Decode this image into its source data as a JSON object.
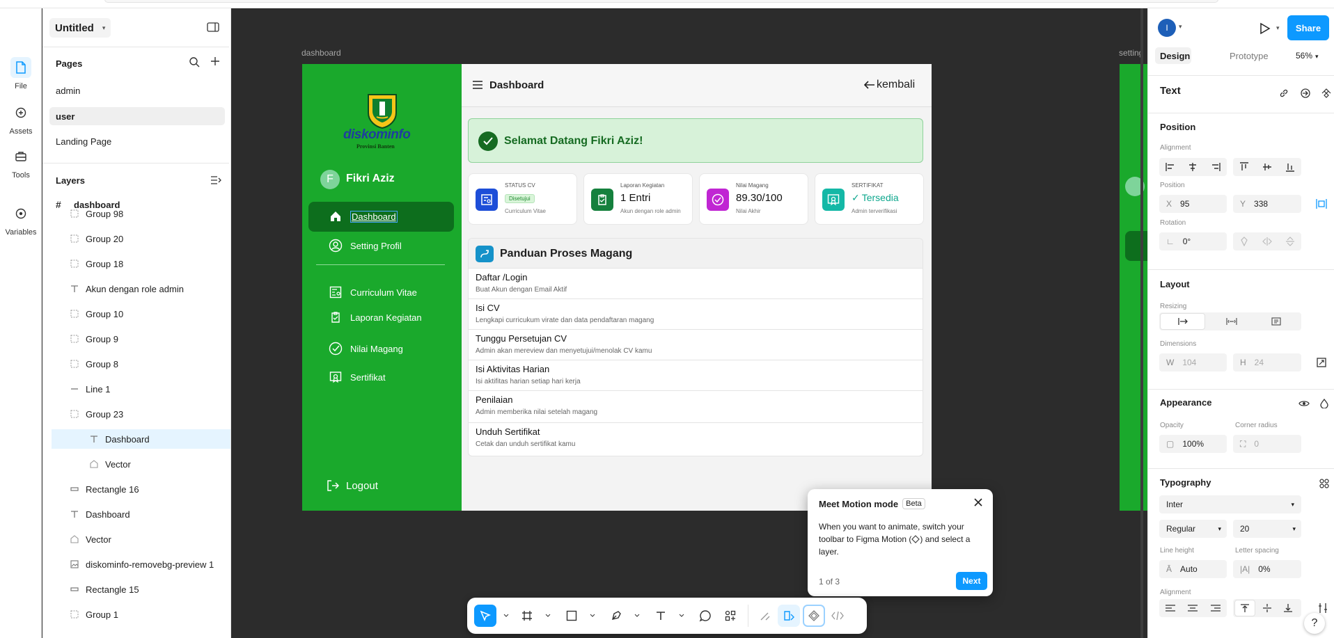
{
  "app": {
    "file_name": "Untitled",
    "accent": "#0d99ff"
  },
  "rail": {
    "file_label": "File",
    "assets_label": "Assets",
    "tools_label": "Tools",
    "variables_label": "Variables"
  },
  "pages": {
    "heading": "Pages",
    "items": [
      "admin",
      "user",
      "Landing Page"
    ],
    "selected": "user"
  },
  "layers": {
    "heading": "Layers",
    "root": "dashboard",
    "items": [
      {
        "label": "Group 98",
        "icon": "group-icon"
      },
      {
        "label": "Group 20",
        "icon": "group-icon"
      },
      {
        "label": "Group 18",
        "icon": "group-icon"
      },
      {
        "label": "Akun dengan role admin",
        "icon": "text-icon"
      },
      {
        "label": "Group 10",
        "icon": "group-icon"
      },
      {
        "label": "Group 9",
        "icon": "group-icon"
      },
      {
        "label": "Group 8",
        "icon": "group-icon"
      },
      {
        "label": "Line 1",
        "icon": "line-icon"
      },
      {
        "label": "Group 23",
        "icon": "group-icon"
      },
      {
        "label": "Dashboard",
        "icon": "text-icon"
      },
      {
        "label": "Vector",
        "icon": "vector-icon"
      },
      {
        "label": "Rectangle 16",
        "icon": "rectangle-icon"
      },
      {
        "label": "Dashboard",
        "icon": "text-icon"
      },
      {
        "label": "Vector",
        "icon": "vector-icon"
      },
      {
        "label": "diskominfo-removebg-preview 1",
        "icon": "image-icon"
      },
      {
        "label": "Rectangle 15",
        "icon": "rectangle-icon"
      },
      {
        "label": "Group 1",
        "icon": "group-icon"
      }
    ]
  },
  "canvas": {
    "frame_label": "dashboard",
    "frame2_label": "setting",
    "sidebar_color": "#1aa92c",
    "logo_text": "diskominfo",
    "logo_sub": "Provinsi Banten",
    "avatar_letter": "F",
    "user_name": "Fikri Aziz",
    "nav": [
      {
        "label": "Dashboard",
        "icon": "home-icon"
      },
      {
        "label": "Setting Profil",
        "icon": "profile-icon"
      },
      {
        "label": "Curriculum Vitae",
        "icon": "cv-icon"
      },
      {
        "label": "Laporan Kegiatan",
        "icon": "report-icon"
      },
      {
        "label": "Nilai Magang",
        "icon": "check-circle-icon"
      },
      {
        "label": "Sertifikat",
        "icon": "certificate-icon"
      }
    ],
    "logout": "Logout",
    "header_title": "Dashboard",
    "back_label": "kembali",
    "welcome": "Selamat Datang Fikri Aziz!",
    "cards": [
      {
        "label": "STATUS CV",
        "value": "Disetujui",
        "sub": "Curriculum Vitae",
        "color": "#1d4ed8"
      },
      {
        "label": "Laporan Kegiatan",
        "value": "1 Entri",
        "sub": "Akun dengan role admin",
        "color": "#15803d"
      },
      {
        "label": "Nilai Magang",
        "value": "89.30/100",
        "sub": "Nilai Akhir",
        "color": "#c026d3"
      },
      {
        "label": "SERTIFIKAT",
        "value": "Tersedia",
        "sub": "Admin terverifikasi",
        "color": "#14b8a6"
      }
    ],
    "guide_title": "Panduan Proses Magang",
    "steps": [
      {
        "title": "Daftar /Login",
        "desc": "Buat Akun dengan Email Aktif"
      },
      {
        "title": "Isi CV",
        "desc": "Lengkapi curricukum virate dan data pendaftaran magang"
      },
      {
        "title": "Tunggu Persetujan CV",
        "desc": "Admin akan mereview dan menyetujui/menolak CV kamu"
      },
      {
        "title": "Isi Aktivitas Harian",
        "desc": "Isi aktifitas harian setiap hari kerja"
      },
      {
        "title": "Penilaian",
        "desc": "Admin memberika nilai setelah magang"
      },
      {
        "title": "Unduh Sertifikat",
        "desc": "Cetak dan unduh sertifikat kamu"
      }
    ]
  },
  "popup": {
    "title": "Meet Motion mode",
    "badge": "Beta",
    "body_1": "When you want to animate, switch your toolbar to Figma Motion (",
    "body_2": ") and select a layer.",
    "counter": "1 of 3",
    "next": "Next"
  },
  "right": {
    "avatar": "I",
    "share": "Share",
    "tabs": [
      "Design",
      "Prototype"
    ],
    "zoom": "56%",
    "layer_type": "Text",
    "position_heading": "Position",
    "alignment_label": "Alignment",
    "position_label": "Position",
    "x": "95",
    "y": "338",
    "rotation_label": "Rotation",
    "rotation": "0°",
    "layout_heading": "Layout",
    "resizing_label": "Resizing",
    "dimensions_label": "Dimensions",
    "w": "104",
    "h": "24",
    "appearance_heading": "Appearance",
    "opacity_label": "Opacity",
    "opacity": "100%",
    "corner_label": "Corner radius",
    "corner": "0",
    "typography_heading": "Typography",
    "font": "Inter",
    "weight": "Regular",
    "size": "20",
    "line_height_label": "Line height",
    "line_height": "Auto",
    "letter_spacing_label": "Letter spacing",
    "letter_spacing": "0%",
    "text_alignment_label": "Alignment"
  }
}
